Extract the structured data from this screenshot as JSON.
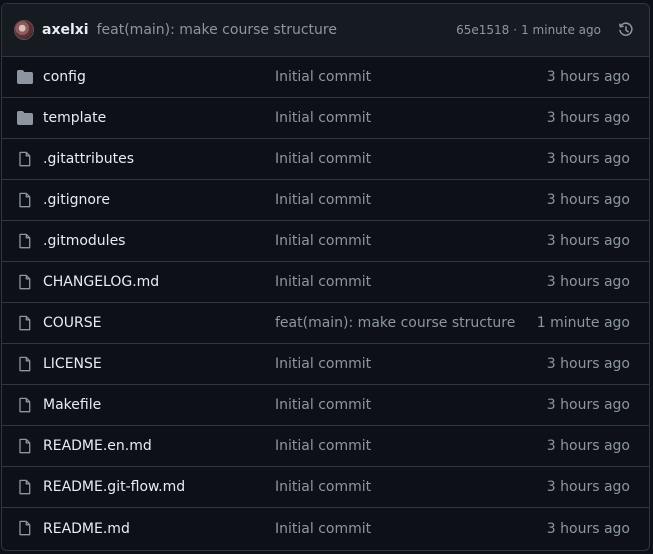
{
  "latest_commit": {
    "author": "axelxi",
    "message": "feat(main): make course structure",
    "sha": "65e1518",
    "separator": "·",
    "age": "1 minute ago",
    "history_icon": "history-icon"
  },
  "files": [
    {
      "name": "config",
      "type": "dir",
      "message": "Initial commit",
      "age": "3 hours ago"
    },
    {
      "name": "template",
      "type": "dir",
      "message": "Initial commit",
      "age": "3 hours ago"
    },
    {
      "name": ".gitattributes",
      "type": "file",
      "message": "Initial commit",
      "age": "3 hours ago"
    },
    {
      "name": ".gitignore",
      "type": "file",
      "message": "Initial commit",
      "age": "3 hours ago"
    },
    {
      "name": ".gitmodules",
      "type": "file",
      "message": "Initial commit",
      "age": "3 hours ago"
    },
    {
      "name": "CHANGELOG.md",
      "type": "file",
      "message": "Initial commit",
      "age": "3 hours ago"
    },
    {
      "name": "COURSE",
      "type": "file",
      "message": "feat(main): make course structure",
      "age": "1 minute ago"
    },
    {
      "name": "LICENSE",
      "type": "file",
      "message": "Initial commit",
      "age": "3 hours ago"
    },
    {
      "name": "Makefile",
      "type": "file",
      "message": "Initial commit",
      "age": "3 hours ago"
    },
    {
      "name": "README.en.md",
      "type": "file",
      "message": "Initial commit",
      "age": "3 hours ago"
    },
    {
      "name": "README.git-flow.md",
      "type": "file",
      "message": "Initial commit",
      "age": "3 hours ago"
    },
    {
      "name": "README.md",
      "type": "file",
      "message": "Initial commit",
      "age": "3 hours ago"
    }
  ],
  "colors": {
    "background": "#0d1117",
    "header_bg": "#161b22",
    "border": "#30363d",
    "text": "#e6edf3",
    "muted": "#8d96a0",
    "folder_icon": "#8d96a0"
  }
}
